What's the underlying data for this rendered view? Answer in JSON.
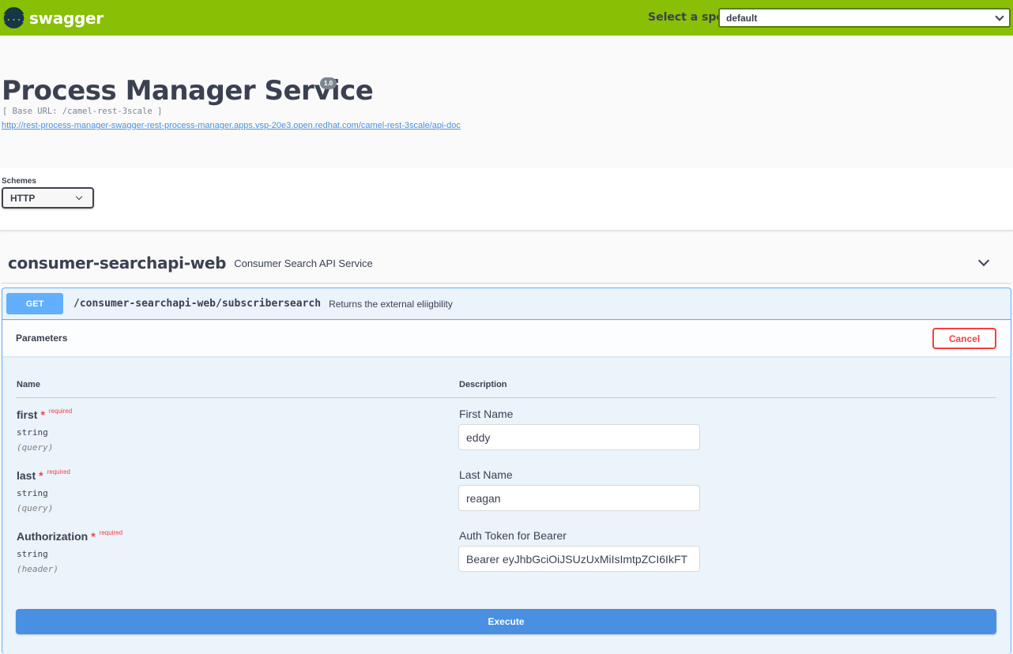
{
  "topbar": {
    "logo_glyph": "{...}",
    "logo_text": "swagger",
    "spec_label": "Select a spec",
    "spec_value": "default"
  },
  "info": {
    "title": "Process Manager Service",
    "version": "1.0",
    "base_url": "[ Base URL: /camel-rest-3scale ]",
    "doc_link": "http://rest-process-manager-swagger-rest-process-manager.apps.vsp-20e3.open.redhat.com/camel-rest-3scale/api-doc"
  },
  "schemes": {
    "label": "Schemes",
    "selected": "HTTP"
  },
  "tag": {
    "name": "consumer-searchapi-web",
    "description": "Consumer Search API Service"
  },
  "operation": {
    "method": "GET",
    "path": "/consumer-searchapi-web/subscribersearch",
    "summary": "Returns the external eliigbility",
    "parameters_title": "Parameters",
    "cancel_label": "Cancel",
    "col_name": "Name",
    "col_description": "Description",
    "execute_label": "Execute",
    "params": [
      {
        "name": "first",
        "star": "*",
        "required": "required",
        "type": "string",
        "in": "(query)",
        "description": "First Name",
        "value": "eddy"
      },
      {
        "name": "last",
        "star": "*",
        "required": "required",
        "type": "string",
        "in": "(query)",
        "description": "Last Name",
        "value": "reagan"
      },
      {
        "name": "Authorization",
        "star": "*",
        "required": "required",
        "type": "string",
        "in": "(header)",
        "description": "Auth Token for Bearer",
        "value": "Bearer eyJhbGciOiJSUzUxMiIsImtpZCI6IkFT"
      }
    ]
  },
  "colors": {
    "topbar_bg": "#89bf04",
    "get_method": "#61affe",
    "cancel": "#f93e3e",
    "execute": "#4990e2"
  }
}
